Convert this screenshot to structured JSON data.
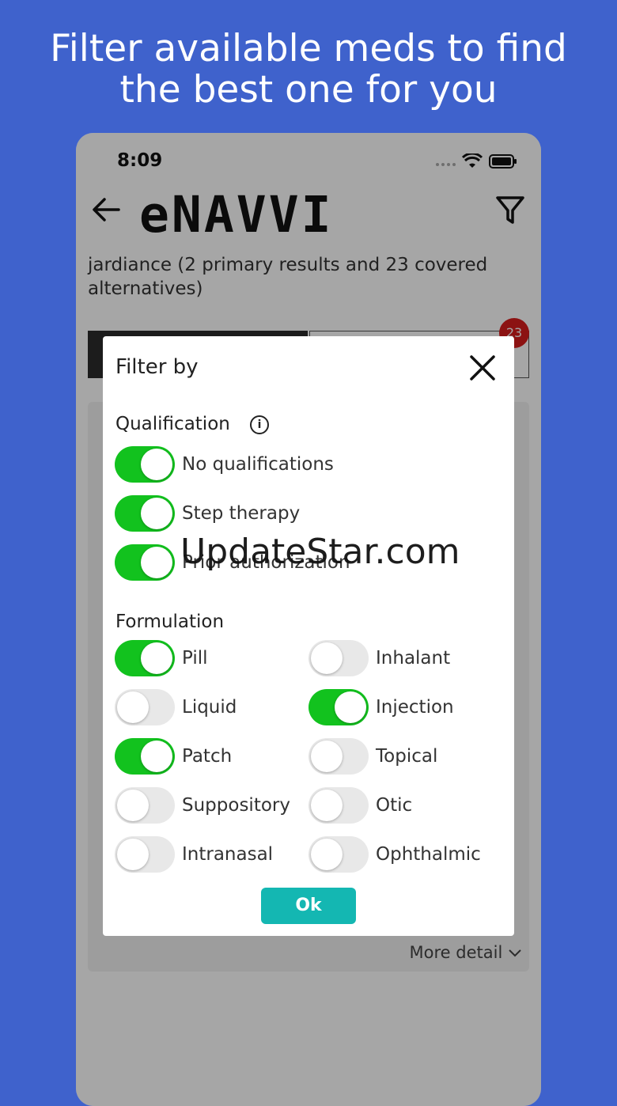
{
  "headline": {
    "line1": "Filter available meds to find",
    "line2": "the best one for you"
  },
  "status_bar": {
    "time": "8:09"
  },
  "nav": {
    "logo": "eNAVVI"
  },
  "search": {
    "title": "jardiance (2 primary results and 23 covered alternatives)"
  },
  "tabs": {
    "badge_count": "23"
  },
  "card": {
    "more_detail": "More detail"
  },
  "dialog": {
    "title": "Filter by",
    "qualification": {
      "heading": "Qualification",
      "items": [
        {
          "label": "No qualifications",
          "on": true
        },
        {
          "label": "Step therapy",
          "on": true
        },
        {
          "label": "Prior authorization",
          "on": true
        }
      ]
    },
    "formulation": {
      "heading": "Formulation",
      "items": [
        {
          "label": "Pill",
          "on": true
        },
        {
          "label": "Inhalant",
          "on": false
        },
        {
          "label": "Liquid",
          "on": false
        },
        {
          "label": "Injection",
          "on": true
        },
        {
          "label": "Patch",
          "on": true
        },
        {
          "label": "Topical",
          "on": false
        },
        {
          "label": "Suppository",
          "on": false
        },
        {
          "label": "Otic",
          "on": false
        },
        {
          "label": "Intranasal",
          "on": false
        },
        {
          "label": "Ophthalmic",
          "on": false
        }
      ]
    },
    "ok_label": "Ok"
  },
  "watermark": "UpdateStar.com",
  "colors": {
    "background": "#3f62cc",
    "toggle_on": "#12c21e",
    "ok_button": "#14b7b2",
    "badge": "#d81c1c"
  }
}
